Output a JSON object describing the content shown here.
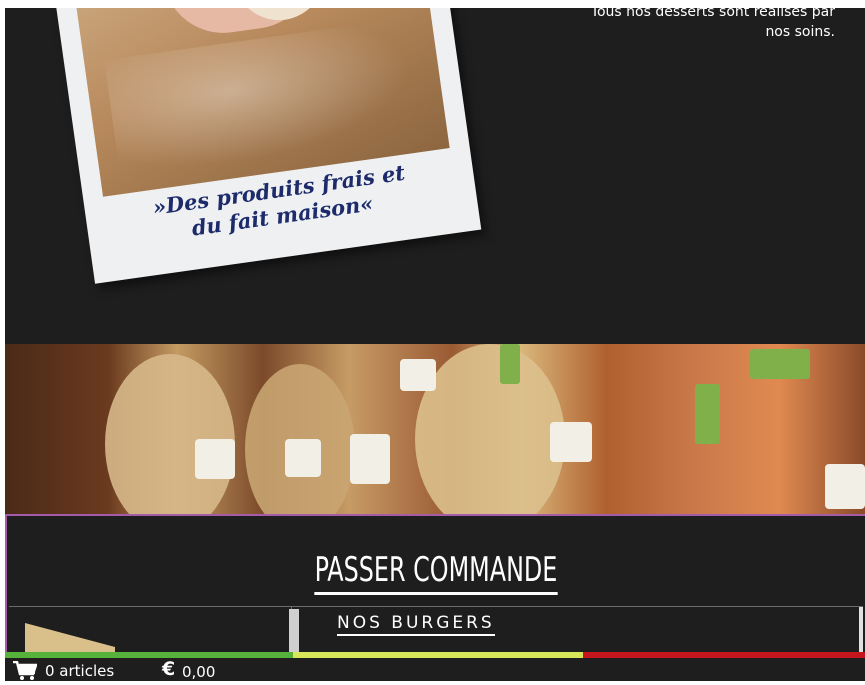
{
  "intro": {
    "line1": "Tous nos desserts sont réalisés par",
    "line2": "nos soins."
  },
  "polaroid": {
    "caption_line1": "»Des produits frais et",
    "caption_line2": "du fait maison«"
  },
  "order": {
    "title": "PASSER COMMANDE",
    "category_link": "NOS BURGERS"
  },
  "cart": {
    "count_text": "0 articles",
    "currency_symbol": "€",
    "total": "0,00"
  },
  "colors": {
    "dark_bg": "#1e1e1e",
    "panel_border": "#a45ca8",
    "bar_green": "#56b23a",
    "bar_lime": "#d8e65a",
    "bar_red": "#c4161c",
    "caption": "#1d2b6b"
  },
  "icons": {
    "cart": "shopping-cart-icon",
    "currency": "euro-icon"
  }
}
